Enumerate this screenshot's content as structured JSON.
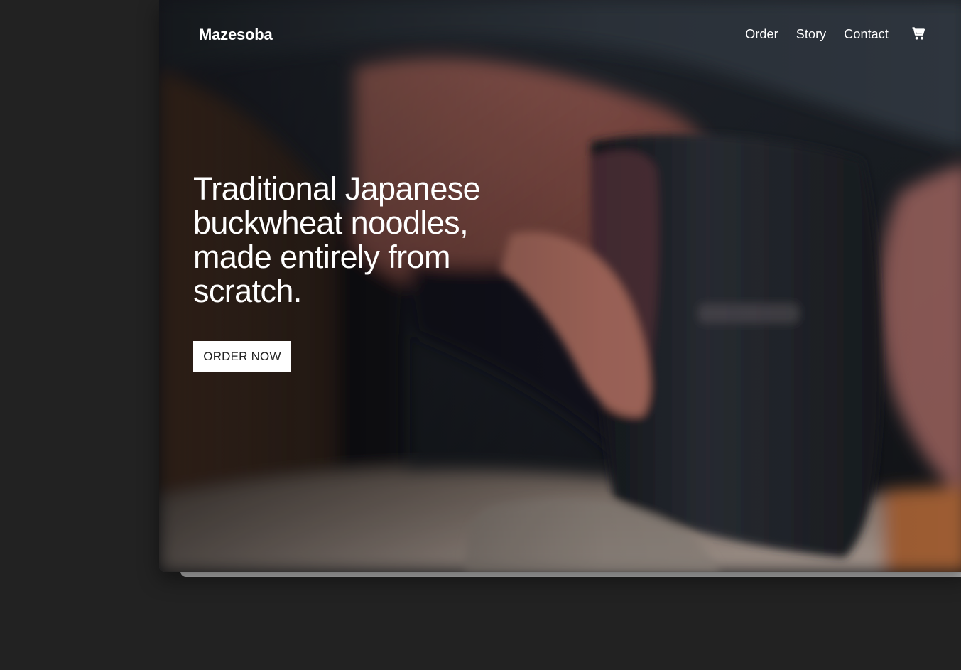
{
  "header": {
    "logo": "Mazesoba",
    "nav": [
      {
        "label": "Order"
      },
      {
        "label": "Story"
      },
      {
        "label": "Contact"
      }
    ],
    "cart_icon": "shopping-cart-icon"
  },
  "hero": {
    "headline": "Traditional Japanese buckwheat noodles, made entirely from scratch.",
    "cta_label": "ORDER NOW",
    "background_image": "blurred photo of a chef cutting soba noodles with a large knife"
  },
  "colors": {
    "page_background": "#222222",
    "text": "#ffffff",
    "button_background": "#ffffff",
    "button_text": "#222222"
  }
}
